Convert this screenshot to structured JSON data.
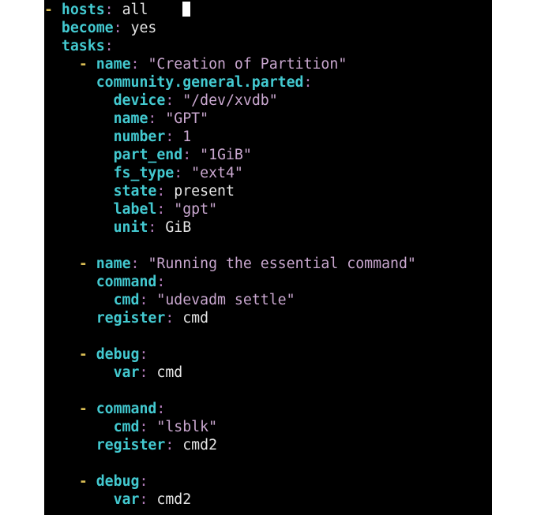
{
  "editor": {
    "lines": [
      {
        "indent": "",
        "dash": "- ",
        "key": "hosts",
        "value": "all",
        "value_type": "plain",
        "cursor": true
      },
      {
        "indent": "  ",
        "dash": "",
        "key": "become",
        "value": "yes",
        "value_type": "plain"
      },
      {
        "indent": "  ",
        "dash": "",
        "key": "tasks",
        "value": "",
        "value_type": "plain"
      },
      {
        "indent": "    ",
        "dash": "- ",
        "key": "name",
        "value": "\"Creation of Partition\"",
        "value_type": "string"
      },
      {
        "indent": "      ",
        "dash": "",
        "key": "community.general.parted",
        "value": "",
        "value_type": "plain"
      },
      {
        "indent": "        ",
        "dash": "",
        "key": "device",
        "value": "\"/dev/xvdb\"",
        "value_type": "string"
      },
      {
        "indent": "        ",
        "dash": "",
        "key": "name",
        "value": "\"GPT\"",
        "value_type": "string"
      },
      {
        "indent": "        ",
        "dash": "",
        "key": "number",
        "value": "1",
        "value_type": "string"
      },
      {
        "indent": "        ",
        "dash": "",
        "key": "part_end",
        "value": "\"1GiB\"",
        "value_type": "string"
      },
      {
        "indent": "        ",
        "dash": "",
        "key": "fs_type",
        "value": "\"ext4\"",
        "value_type": "string"
      },
      {
        "indent": "        ",
        "dash": "",
        "key": "state",
        "value": "present",
        "value_type": "plain"
      },
      {
        "indent": "        ",
        "dash": "",
        "key": "label",
        "value": "\"gpt\"",
        "value_type": "string"
      },
      {
        "indent": "        ",
        "dash": "",
        "key": "unit",
        "value": "GiB",
        "value_type": "plain"
      },
      {
        "blank": true
      },
      {
        "indent": "    ",
        "dash": "- ",
        "key": "name",
        "value": "\"Running the essential command\"",
        "value_type": "string"
      },
      {
        "indent": "      ",
        "dash": "",
        "key": "command",
        "value": "",
        "value_type": "plain"
      },
      {
        "indent": "        ",
        "dash": "",
        "key": "cmd",
        "value": "\"udevadm settle\"",
        "value_type": "string"
      },
      {
        "indent": "      ",
        "dash": "",
        "key": "register",
        "value": "cmd",
        "value_type": "plain"
      },
      {
        "blank": true
      },
      {
        "indent": "    ",
        "dash": "- ",
        "key": "debug",
        "value": "",
        "value_type": "plain"
      },
      {
        "indent": "        ",
        "dash": "",
        "key": "var",
        "value": "cmd",
        "value_type": "plain"
      },
      {
        "blank": true
      },
      {
        "indent": "    ",
        "dash": "- ",
        "key": "command",
        "value": "",
        "value_type": "plain"
      },
      {
        "indent": "        ",
        "dash": "",
        "key": "cmd",
        "value": "\"lsblk\"",
        "value_type": "string"
      },
      {
        "indent": "      ",
        "dash": "",
        "key": "register",
        "value": "cmd2",
        "value_type": "plain"
      },
      {
        "blank": true
      },
      {
        "indent": "    ",
        "dash": "- ",
        "key": "debug",
        "value": "",
        "value_type": "plain"
      },
      {
        "indent": "        ",
        "dash": "",
        "key": "var",
        "value": "cmd2",
        "value_type": "plain"
      }
    ]
  },
  "colors": {
    "background": "#000000",
    "key": "#43c9d0",
    "dash": "#d9bd54",
    "colon": "#b17bb8",
    "string": "#c9a7cf",
    "plain": "#e6e6e6"
  }
}
